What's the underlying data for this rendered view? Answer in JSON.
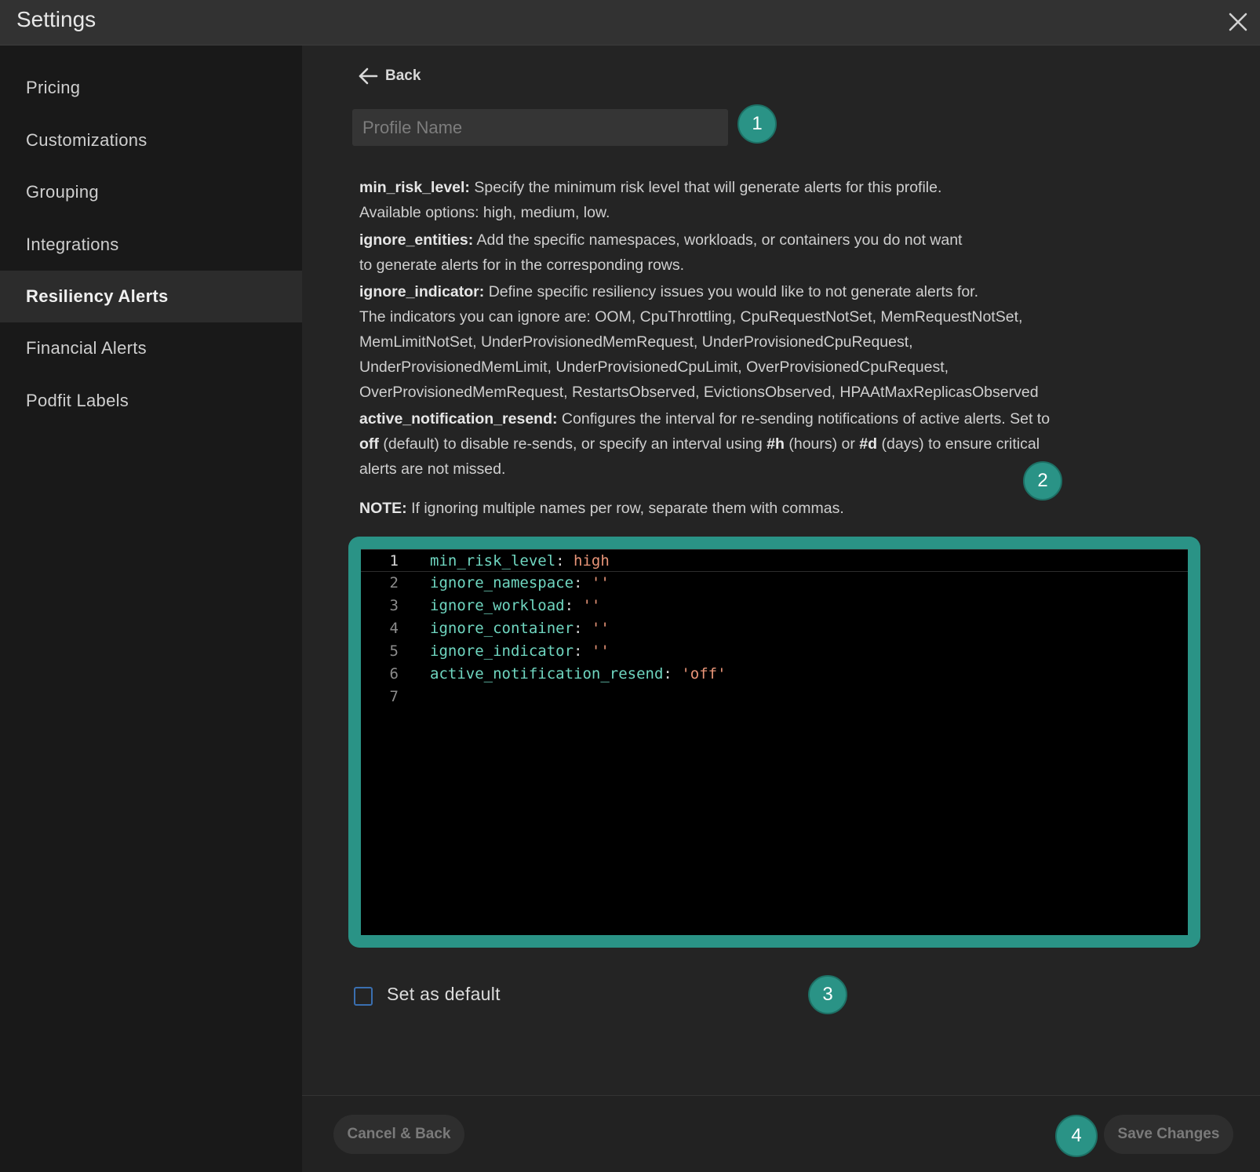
{
  "window": {
    "title": "Settings"
  },
  "sidebar": {
    "items": [
      {
        "label": "Pricing"
      },
      {
        "label": "Customizations"
      },
      {
        "label": "Grouping"
      },
      {
        "label": "Integrations"
      },
      {
        "label": "Resiliency Alerts",
        "active": true
      },
      {
        "label": "Financial Alerts"
      },
      {
        "label": "Podfit Labels"
      }
    ]
  },
  "main": {
    "back_label": "Back",
    "profile_name": {
      "placeholder": "Profile Name",
      "value": ""
    },
    "descriptions": {
      "min_risk": {
        "term": "min_risk_level:",
        "text1": " Specify the minimum risk level that will generate alerts for this profile.",
        "text2": "Available options: high, medium, low."
      },
      "ignore_entities": {
        "term": "ignore_entities:",
        "text1": " Add the specific namespaces, workloads, or containers you do not want",
        "text2": "to generate alerts for in the corresponding rows."
      },
      "ignore_indicator": {
        "term": "ignore_indicator:",
        "text1": " Define specific resiliency issues you would like to not generate alerts for.",
        "text2": "The indicators you can ignore are: OOM, CpuThrottling, CpuRequestNotSet, MemRequestNotSet,",
        "text3": "MemLimitNotSet, UnderProvisionedMemRequest, UnderProvisionedCpuRequest,",
        "text4": "UnderProvisionedMemLimit, UnderProvisionedCpuLimit, OverProvisionedCpuRequest,",
        "text5": "OverProvisionedMemRequest, RestartsObserved, EvictionsObserved, HPAAtMaxReplicasObserved"
      },
      "active_resend": {
        "term": "active_notification_resend:",
        "text1": " Configures the interval for re-sending notifications of active alerts. Set to",
        "off": "off",
        "text2": " (default) to disable re-sends, or specify an interval using ",
        "h": "#h",
        "text3": " (hours) or ",
        "d": "#d",
        "text4": " (days) to ensure critical",
        "text5": "alerts are not missed."
      },
      "note": {
        "term": "NOTE:",
        "text": " If ignoring multiple names per row, separate them with commas."
      }
    },
    "editor": {
      "lines": [
        {
          "num": "1",
          "key": "min_risk_level",
          "sep": ": ",
          "value": "high"
        },
        {
          "num": "2",
          "key": "ignore_namespace",
          "sep": ": ",
          "value": "''"
        },
        {
          "num": "3",
          "key": "ignore_workload",
          "sep": ": ",
          "value": "''"
        },
        {
          "num": "4",
          "key": "ignore_container",
          "sep": ": ",
          "value": "''"
        },
        {
          "num": "5",
          "key": "ignore_indicator",
          "sep": ": ",
          "value": "''"
        },
        {
          "num": "6",
          "key": "active_notification_resend",
          "sep": ": ",
          "value": "'off'"
        },
        {
          "num": "7",
          "key": "",
          "sep": "",
          "value": ""
        }
      ]
    },
    "default_checkbox": {
      "label": "Set as default",
      "checked": false
    }
  },
  "footer": {
    "cancel_label": "Cancel & Back",
    "save_label": "Save Changes"
  },
  "badges": [
    "1",
    "2",
    "3",
    "4"
  ],
  "colors": {
    "accent": "#2a9386",
    "code_key": "#6fd6c0",
    "code_value": "#e99578",
    "checkbox_border": "#3a6fb0"
  }
}
